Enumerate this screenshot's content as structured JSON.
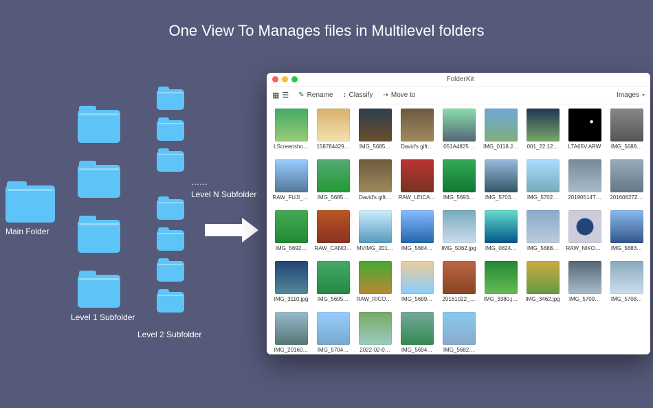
{
  "headline": "One View To Manages files in Multilevel folders",
  "diagram": {
    "main_label": "Main Folder",
    "level1_label": "Level 1 Subfolder",
    "level2_label": "Level 2 Subfolder",
    "dots": "……",
    "level_n_label": "Level N Subfolder"
  },
  "app": {
    "title": "FolderKit",
    "toolbar": {
      "rename": "Rename",
      "classify": "Classify",
      "move_to": "Move to",
      "filter_label": "Images"
    },
    "thumbs": [
      {
        "label": "LScreensho…",
        "bg": "linear-gradient(#4a6,#9c7)"
      },
      {
        "label": "158784429…",
        "bg": "linear-gradient(#d7b26b,#f4e1b0)"
      },
      {
        "label": "IMG_5685…",
        "bg": "linear-gradient(#2c3e50,#6b4f2a)"
      },
      {
        "label": "David's gift…",
        "bg": "linear-gradient(#6d5a3f,#a08a5e)"
      },
      {
        "label": "051A4825…",
        "bg": "linear-gradient(#8da,#567)"
      },
      {
        "label": "IMG_0118.J…",
        "bg": "linear-gradient(#6fa7d6,#7fae7c)"
      },
      {
        "label": "001_22.12…",
        "bg": "linear-gradient(#235,#7a6)"
      },
      {
        "label": "LTA65V.ARW",
        "bg": "radial-gradient(circle at 70% 40%, #fff 0 4%, #000 6%)"
      },
      {
        "label": "IMG_5689…",
        "bg": "linear-gradient(#888,#555)"
      },
      {
        "label": "RAW_FUJI_X…",
        "bg": "linear-gradient(#9cf,#579)"
      },
      {
        "label": "IMG_5685…",
        "bg": "linear-gradient(#5a7,#293)"
      },
      {
        "label": "David's gift…",
        "bg": "linear-gradient(#6d5a3f,#a08a5e)"
      },
      {
        "label": "RAW_LEICA_…",
        "bg": "linear-gradient(#b33,#732)"
      },
      {
        "label": "IMG_5693…",
        "bg": "linear-gradient(#3a5,#173)"
      },
      {
        "label": "IMG_5703…",
        "bg": "linear-gradient(#9bd,#356)"
      },
      {
        "label": "IMG_5702…",
        "bg": "linear-gradient(#adf,#7ab)"
      },
      {
        "label": "20190514T…",
        "bg": "linear-gradient(#789,#abc)"
      },
      {
        "label": "20160827Z…",
        "bg": "linear-gradient(#9ab,#678)"
      },
      {
        "label": "IMG_5692…",
        "bg": "linear-gradient(#4a5,#283)"
      },
      {
        "label": "RAW_CANO…",
        "bg": "linear-gradient(#b52,#832)"
      },
      {
        "label": "MVIMG_201…",
        "bg": "linear-gradient(#cef,#59b)"
      },
      {
        "label": "IMG_5684…",
        "bg": "linear-gradient(#8bf,#26a)"
      },
      {
        "label": "IMG_5062.jpg",
        "bg": "linear-gradient(#7ab,#cde)"
      },
      {
        "label": "IMG_0824…",
        "bg": "linear-gradient(#6dc,#058)"
      },
      {
        "label": "IMG_5688…",
        "bg": "linear-gradient(#8ac,#bcd)"
      },
      {
        "label": "RAW_NIKON…",
        "bg": "radial-gradient(circle,#247 0 35%,#ccd 38%)"
      },
      {
        "label": "IMG_5683…",
        "bg": "linear-gradient(#8be,#358)"
      },
      {
        "label": "IMG_3110.jpg",
        "bg": "linear-gradient(#247,#589)"
      },
      {
        "label": "IMG_5695…",
        "bg": "linear-gradient(#4a6,#284)"
      },
      {
        "label": "RAW_RICOH…",
        "bg": "linear-gradient(#4a3,#b83)"
      },
      {
        "label": "IMG_5699…",
        "bg": "linear-gradient(#ec9,#8cf)"
      },
      {
        "label": "20161022_…",
        "bg": "linear-gradient(#b64,#842)"
      },
      {
        "label": "IMG_3380.j…",
        "bg": "linear-gradient(#283,#6b5)"
      },
      {
        "label": "IMG_3462.jpg",
        "bg": "linear-gradient(#ca4,#694)"
      },
      {
        "label": "IMG_5709…",
        "bg": "linear-gradient(#567,#abc)"
      },
      {
        "label": "IMG_5708…",
        "bg": "linear-gradient(#8ab,#cde)"
      },
      {
        "label": "IMG_20160…",
        "bg": "linear-gradient(#9bc,#577)"
      },
      {
        "label": "IMG_5704…",
        "bg": "linear-gradient(#9cf,#7ac)"
      },
      {
        "label": "2022-02-0…",
        "bg": "linear-gradient(#7a6,#9cb)"
      },
      {
        "label": "IMG_5694…",
        "bg": "linear-gradient(#7a9,#385)"
      },
      {
        "label": "IMG_5682…",
        "bg": "linear-gradient(#8ce,#8ac)"
      }
    ]
  }
}
